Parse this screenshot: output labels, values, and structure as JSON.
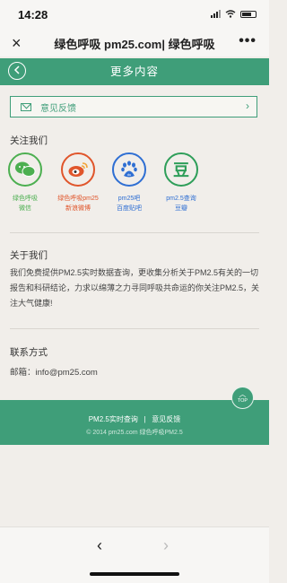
{
  "status": {
    "time": "14:28"
  },
  "browser": {
    "title": "绿色呼吸 pm25.com| 绿色呼吸",
    "close_icon": "×",
    "more_icon": "•••"
  },
  "header": {
    "title": "更多内容",
    "back_icon": "chevron-left"
  },
  "feedback": {
    "label": "意见反馈"
  },
  "follow": {
    "title": "关注我们",
    "items": [
      {
        "name": "绿色呼吸",
        "sub": "微信",
        "color": "#4caf50",
        "icon": "wechat-icon"
      },
      {
        "name": "绿色呼吸pm25",
        "sub": "新浪微博",
        "color": "#e0552b",
        "icon": "weibo-icon"
      },
      {
        "name": "pm25吧",
        "sub": "百度贴吧",
        "color": "#2f6fd3",
        "icon": "baidu-icon"
      },
      {
        "name": "pm2.5查询",
        "sub": "豆瓣",
        "color": "#2e9e59",
        "icon": "douban-icon",
        "glyph": "豆"
      }
    ]
  },
  "about": {
    "title": "关于我们",
    "text": "我们免费提供PM2.5实时数据查询，更收集分析关于PM2.5有关的一切报告和科研结论，力求以绵薄之力寻同呼吸共命运的你关注PM2.5，关注大气健康!"
  },
  "contact": {
    "title": "联系方式",
    "email": "邮箱：info@pm25.com"
  },
  "footer": {
    "link1": "PM2.5实时查询",
    "separator": "|",
    "link2": "意见反馈",
    "copyright": "© 2014 pm25.com 绿色呼吸PM2.5"
  },
  "top_button": {
    "label": "TOP"
  },
  "colors": {
    "accent": "#3f9e79"
  }
}
